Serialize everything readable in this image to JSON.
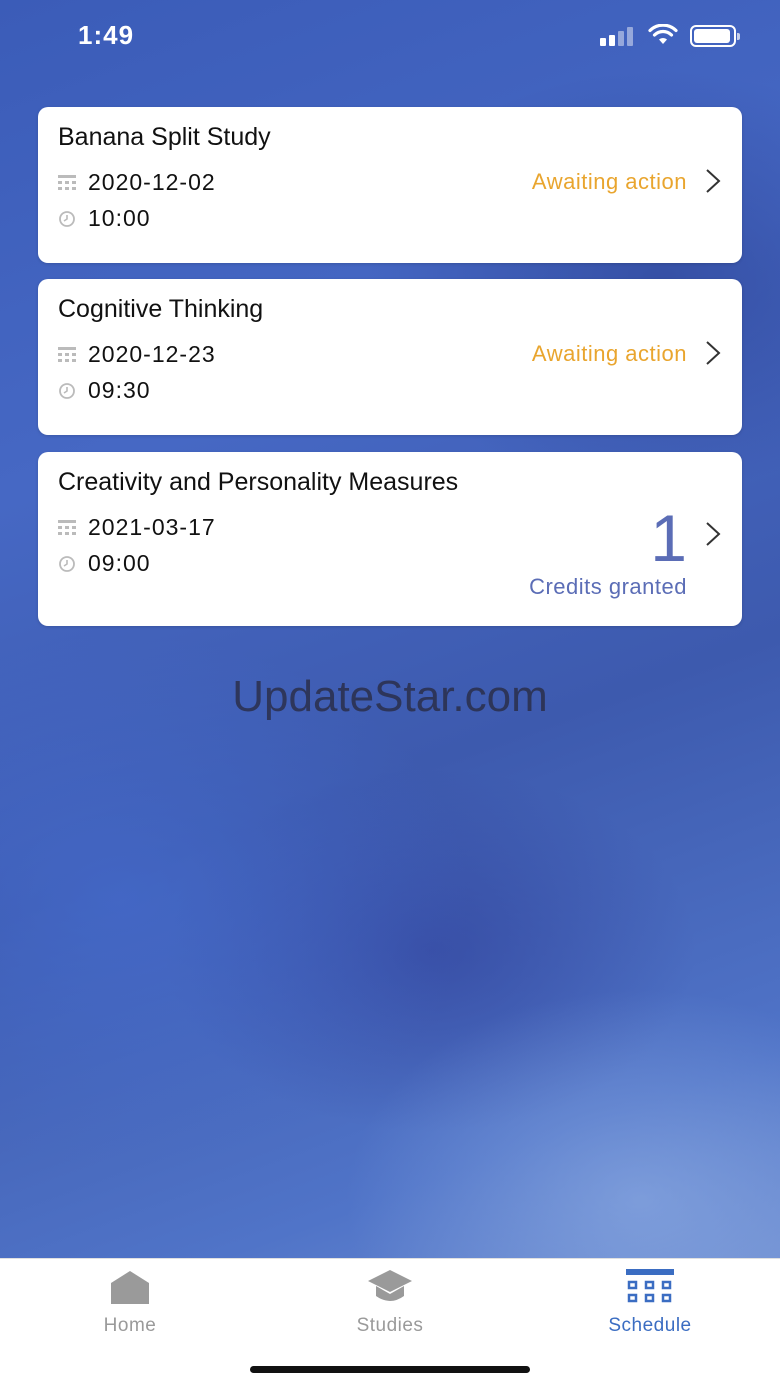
{
  "status_bar": {
    "time": "1:49"
  },
  "cards": [
    {
      "title": "Banana Split Study",
      "date": "2020-12-02",
      "time": "10:00",
      "status": "Awaiting action"
    },
    {
      "title": "Cognitive Thinking",
      "date": "2020-12-23",
      "time": "09:30",
      "status": "Awaiting action"
    },
    {
      "title": "Creativity and Personality Measures",
      "date": "2021-03-17",
      "time": "09:00",
      "credits": "1",
      "credits_label": "Credits granted"
    }
  ],
  "watermark": "UpdateStar.com",
  "tabs": [
    {
      "label": "Home",
      "icon": "home-icon"
    },
    {
      "label": "Studies",
      "icon": "graduation-cap-icon"
    },
    {
      "label": "Schedule",
      "icon": "calendar-icon"
    }
  ],
  "colors": {
    "awaiting": "#e9a52e",
    "credits": "#5b6db6",
    "active_tab": "#3b6dc2"
  }
}
